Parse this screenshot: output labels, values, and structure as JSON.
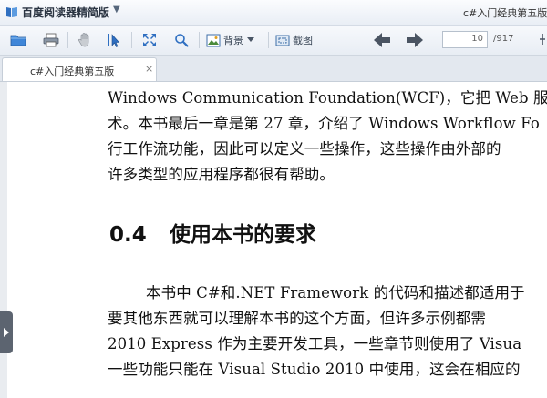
{
  "app": {
    "title": "百度阅读器精简版",
    "menu_caret": "▼",
    "document_title": "c#入门经典第五版"
  },
  "toolbar": {
    "background_label": "背景",
    "screenshot_label": "截图",
    "current_page": "10",
    "total_pages": "/917"
  },
  "tabs": [
    {
      "label": "c#入门经典第五版",
      "close": "×"
    }
  ],
  "page": {
    "lines_top": [
      "Windows Communication Foundation(WCF)，它把 Web 服务的",
      "术。本书最后一章是第 27 章，介绍了 Windows Workflow Fo",
      "行工作流功能，因此可以定义一些操作，这些操作由外部的",
      "许多类型的应用程序都很有帮助。"
    ],
    "section_number": "0.4",
    "section_title": "使用本书的要求",
    "lines_bottom": [
      "本书中 C#和.NET Framework 的代码和描述都适用于",
      "要其他东西就可以理解本书的这个方面，但许多示例都需",
      "2010 Express 作为主要开发工具，一些章节则使用了 Visua",
      "一些功能只能在 Visual Studio 2010 中使用，这会在相应的"
    ]
  },
  "colors": {
    "accent_blue": "#2f6fc1",
    "toolbar_bg": "#eef2f7",
    "handle": "#5c6470"
  }
}
